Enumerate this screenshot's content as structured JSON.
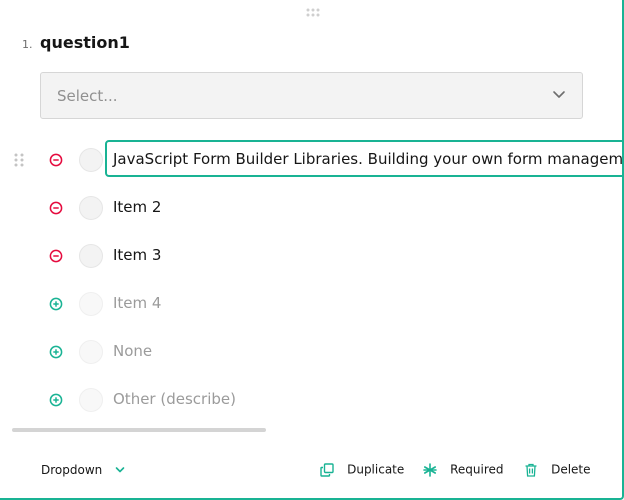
{
  "question": {
    "number": "1.",
    "title": "question1"
  },
  "dropdown": {
    "placeholder": "Select..."
  },
  "choices": [
    {
      "label": "JavaScript Form Builder Libraries. Building your own form managem",
      "state": "editing",
      "action": "remove"
    },
    {
      "label": "Item 2",
      "state": "normal",
      "action": "remove"
    },
    {
      "label": "Item 3",
      "state": "normal",
      "action": "remove"
    },
    {
      "label": "Item 4",
      "state": "placeholder",
      "action": "add"
    },
    {
      "label": "None",
      "state": "placeholder",
      "action": "add"
    },
    {
      "label": "Other (describe)",
      "state": "placeholder",
      "action": "add"
    }
  ],
  "footer": {
    "type_label": "Dropdown",
    "duplicate_label": "Duplicate",
    "required_label": "Required",
    "delete_label": "Delete"
  },
  "colors": {
    "accent": "#19b394",
    "remove": "#e50a3e",
    "border": "#d6d6d6"
  }
}
